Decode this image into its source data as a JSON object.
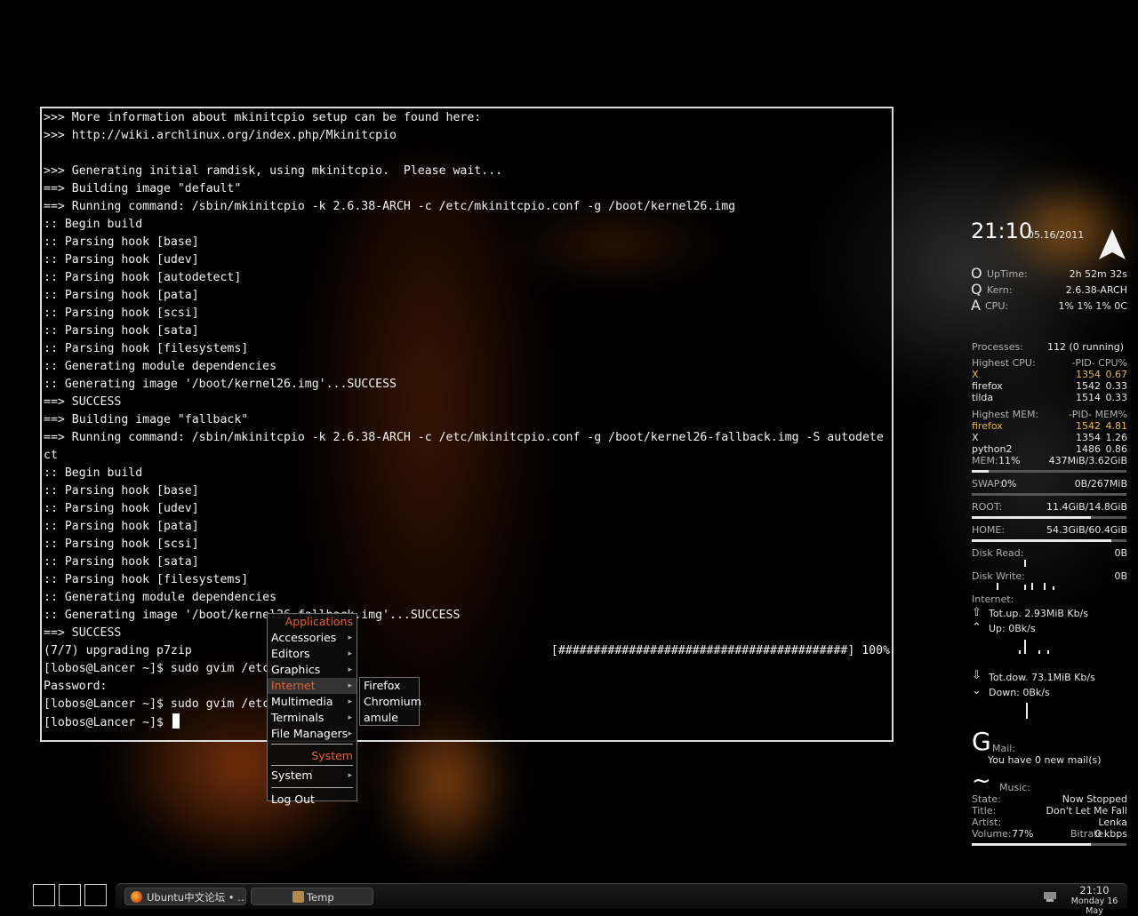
{
  "terminal": {
    "lines": [
      ">>> More information about mkinitcpio setup can be found here:",
      ">>> http://wiki.archlinux.org/index.php/Mkinitcpio",
      "",
      ">>> Generating initial ramdisk, using mkinitcpio.  Please wait...",
      "==> Building image \"default\"",
      "==> Running command: /sbin/mkinitcpio -k 2.6.38-ARCH -c /etc/mkinitcpio.conf -g /boot/kernel26.img",
      ":: Begin build",
      ":: Parsing hook [base]",
      ":: Parsing hook [udev]",
      ":: Parsing hook [autodetect]",
      ":: Parsing hook [pata]",
      ":: Parsing hook [scsi]",
      ":: Parsing hook [sata]",
      ":: Parsing hook [filesystems]",
      ":: Generating module dependencies",
      ":: Generating image '/boot/kernel26.img'...SUCCESS",
      "==> SUCCESS",
      "==> Building image \"fallback\"",
      "==> Running command: /sbin/mkinitcpio -k 2.6.38-ARCH -c /etc/mkinitcpio.conf -g /boot/kernel26-fallback.img -S autodete",
      "ct",
      ":: Begin build",
      ":: Parsing hook [base]",
      ":: Parsing hook [udev]",
      ":: Parsing hook [pata]",
      ":: Parsing hook [scsi]",
      ":: Parsing hook [sata]",
      ":: Parsing hook [filesystems]",
      ":: Generating module dependencies",
      ":: Generating image '/boot/kernel26-fallback.img'...SUCCESS",
      "==> SUCCESS",
      "(7/7) upgrading p7zip",
      "[lobos@Lancer ~]$ sudo gvim /etc",
      "Password:",
      "[lobos@Lancer ~]$ sudo gvim /etc",
      "[lobos@Lancer ~]$ "
    ],
    "progress_text": "[#########################################] 100%"
  },
  "menu": {
    "header": "Applications",
    "items": [
      "Accessories",
      "Editors",
      "Graphics",
      "Internet",
      "Multimedia",
      "Terminals",
      "File Managers"
    ],
    "active_item": "Internet",
    "system_header": "System",
    "system_item": "System",
    "logout": "Log Out",
    "submenu": [
      "Firefox",
      "Chromium",
      "amule"
    ]
  },
  "conky": {
    "time": "21:10",
    "date": "05.16/2011",
    "uptime_label": "UpTime:",
    "uptime": "2h 52m 32s",
    "kern_label": "Kern:",
    "kern": "2.6.38-ARCH",
    "cpu_label": "CPU:",
    "cpu": "1% 1% 1% 0C",
    "icon_o": "O",
    "icon_q": "Q",
    "icon_a": "A",
    "processes_label": "Processes:",
    "processes": "112  (0 running)",
    "highest_cpu_label": "Highest CPU:",
    "pid_cpu_header": "-PID-   CPU%",
    "top_cpu": [
      {
        "name": "X",
        "pid": "1354",
        "val": "0.67"
      },
      {
        "name": "firefox",
        "pid": "1542",
        "val": "0.33"
      },
      {
        "name": "tilda",
        "pid": "1514",
        "val": "0.33"
      }
    ],
    "highest_mem_label": "Highest MEM:",
    "pid_mem_header": "-PID-   MEM%",
    "top_mem": [
      {
        "name": "firefox",
        "pid": "1542",
        "val": "4.81"
      },
      {
        "name": "X",
        "pid": "1354",
        "val": "1.26"
      },
      {
        "name": "python2",
        "pid": "1486",
        "val": "0.86"
      }
    ],
    "mem_label": "MEM:",
    "mem_pct": "11%",
    "mem": "437MiB/3.62GiB",
    "mem_fraction": 0.11,
    "swap_label": "SWAP:",
    "swap_pct": "0%",
    "swap": "0B/267MiB",
    "swap_fraction": 0.0,
    "root_label": "ROOT:",
    "root": "11.4GiB/14.8GiB",
    "root_fraction": 0.77,
    "home_label": "HOME:",
    "home": "54.3GiB/60.4GiB",
    "home_fraction": 0.9,
    "disk_read_label": "Disk Read:",
    "disk_read": "0B",
    "disk_write_label": "Disk Write:",
    "disk_write": "0B",
    "internet_label": "Internet:",
    "tot_up": "Tot.up. 2.93MiB Kb/s",
    "up": "Up: 0Bk/s",
    "tot_down": "Tot.dow. 73.1MiB Kb/s",
    "down": "Down: 0Bk/s",
    "mail_letter": "G",
    "mail_label": "Mail:",
    "mail": "You have 0 new mail(s)",
    "music_letter": "~",
    "music_label": "Music:",
    "state_label": "State:",
    "state": "Now Stopped",
    "title_label": "Title:",
    "title": "Don't Let Me Fall",
    "artist_label": "Artist:",
    "artist": "Lenka",
    "volume_label": "Volume:",
    "volume": "77%",
    "bitrate_label": "Bitrate:",
    "bitrate": "0 kbps",
    "volume_fraction": 0.77
  },
  "taskbar": {
    "tasks": [
      "Ubuntu中文论坛 • …",
      "Temp"
    ],
    "clock_time": "21:10",
    "clock_date": "Monday 16 May"
  },
  "colors": {
    "accent": "#e0613a",
    "highlight": "#e8b84a"
  }
}
